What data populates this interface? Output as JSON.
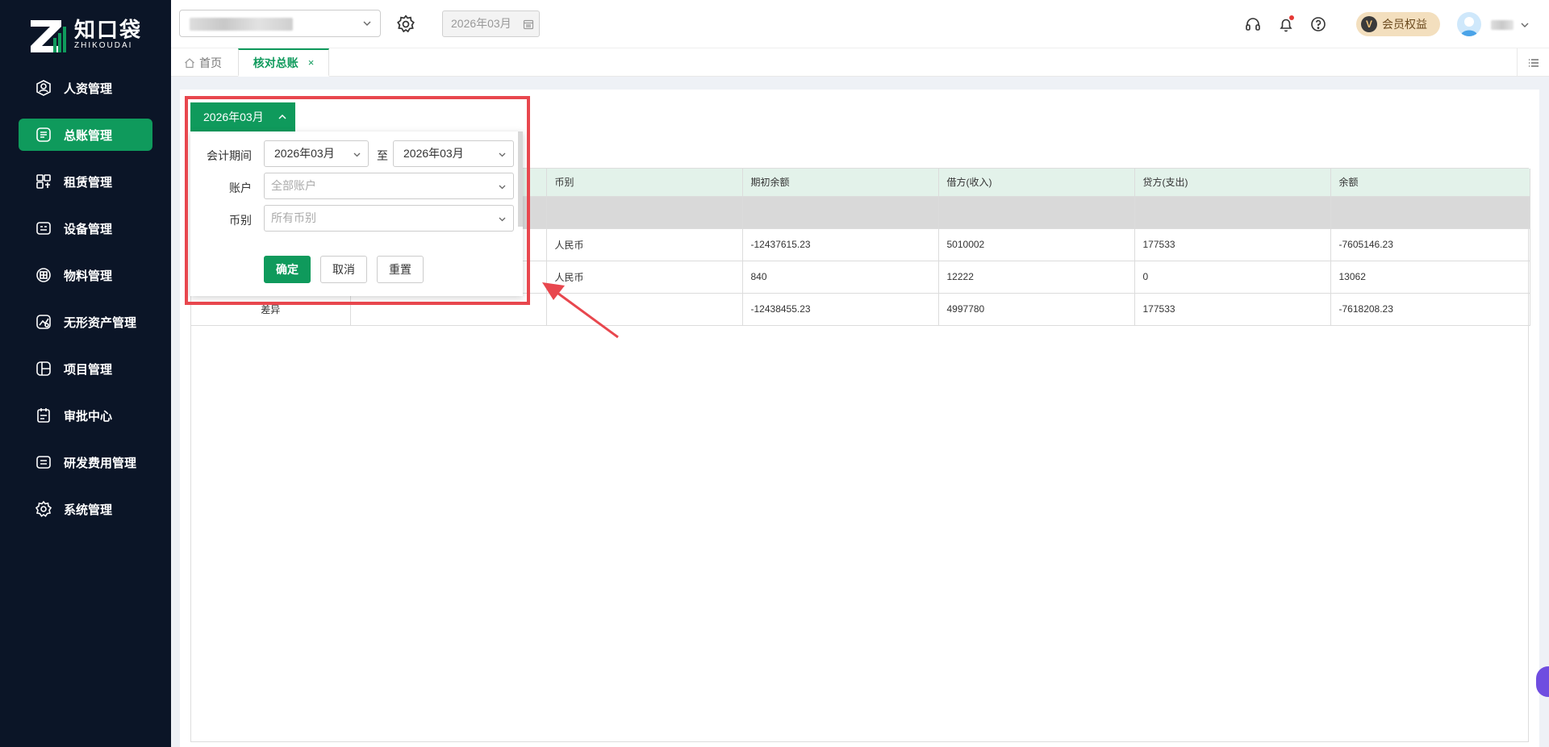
{
  "brand": {
    "name_cn": "知口袋",
    "name_en": "ZHIKOUDAI",
    "color": "#0f9a5c"
  },
  "sidebar": {
    "items": [
      {
        "label": "人资管理",
        "icon": "person-badge-icon",
        "active": false
      },
      {
        "label": "总账管理",
        "icon": "ledger-icon",
        "active": true
      },
      {
        "label": "租赁管理",
        "icon": "lease-icon",
        "active": false
      },
      {
        "label": "设备管理",
        "icon": "device-icon",
        "active": false
      },
      {
        "label": "物料管理",
        "icon": "material-box-icon",
        "active": false
      },
      {
        "label": "无形资产管理",
        "icon": "intangible-asset-icon",
        "active": false
      },
      {
        "label": "项目管理",
        "icon": "project-icon",
        "active": false
      },
      {
        "label": "审批中心",
        "icon": "approval-icon",
        "active": false
      },
      {
        "label": "研发费用管理",
        "icon": "rd-expense-icon",
        "active": false
      },
      {
        "label": "系统管理",
        "icon": "settings-gear-icon",
        "active": false
      }
    ]
  },
  "topbar": {
    "period": "2026年03月",
    "member_label": "会员权益",
    "member_badge": "V"
  },
  "tabs": {
    "home": "首页",
    "active": "核对总账",
    "close": "×"
  },
  "filter": {
    "trigger_label": "2026年03月",
    "period_label": "会计期间",
    "period_from": "2026年03月",
    "to_label": "至",
    "period_to": "2026年03月",
    "account_label": "账户",
    "account_placeholder": "全部账户",
    "currency_label": "币别",
    "currency_placeholder": "所有币别",
    "confirm": "确定",
    "cancel": "取消",
    "reset": "重置"
  },
  "table": {
    "headers": [
      "",
      "",
      "币别",
      "期初余额",
      "借方(收入)",
      "贷方(支出)",
      "余额"
    ],
    "rows": [
      [
        "",
        "",
        "人民币",
        "-12437615.23",
        "5010002",
        "177533",
        "-7605146.23"
      ],
      [
        "",
        "",
        "人民币",
        "840",
        "12222",
        "0",
        "13062"
      ],
      [
        "差异",
        "",
        "",
        "-12438455.23",
        "4997780",
        "177533",
        "-7618208.23"
      ]
    ]
  }
}
